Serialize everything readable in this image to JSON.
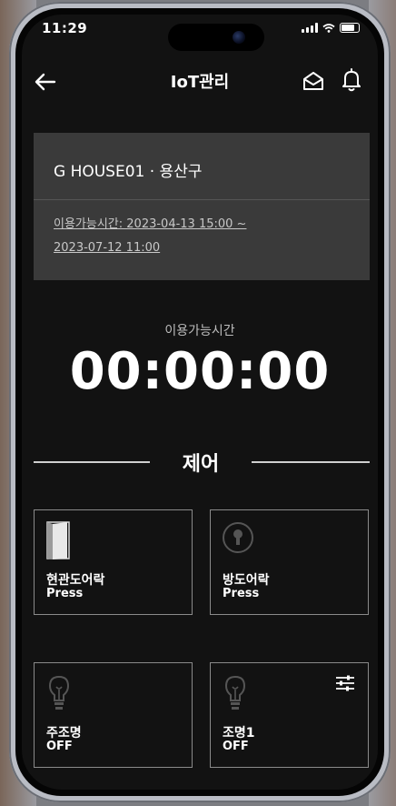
{
  "status_bar": {
    "time": "11:29"
  },
  "header": {
    "title": "IoT관리"
  },
  "property": {
    "name": "G HOUSE01 · 용산구",
    "period_line1": "이용가능시간: 2023-04-13 15:00 ~",
    "period_line2": "2023-07-12 11:00"
  },
  "timer": {
    "label": "이용가능시간",
    "value": "00:00:00"
  },
  "control_section": {
    "title": "제어"
  },
  "controls": [
    {
      "label": "현관도어락",
      "state": "Press",
      "icon": "door-icon"
    },
    {
      "label": "방도어락",
      "state": "Press",
      "icon": "keyhole-icon"
    },
    {
      "label": "주조명",
      "state": "OFF",
      "icon": "bulb-icon"
    },
    {
      "label": "조명1",
      "state": "OFF",
      "icon": "bulb-icon",
      "has_settings": true
    }
  ],
  "colors": {
    "screen_bg": "#121212",
    "card_bg": "#3a3a3a",
    "tile_border": "#8a8a8a"
  }
}
